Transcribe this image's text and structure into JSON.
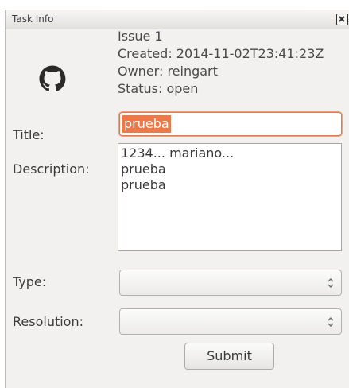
{
  "window": {
    "title": "Task Info"
  },
  "issue": {
    "number": "Issue 1",
    "created": "Created: 2014-11-02T23:41:23Z",
    "owner": "Owner: reingart",
    "status": "Status: open"
  },
  "form": {
    "title_label": "Title:",
    "title_value": "prueba",
    "description_label": "Description:",
    "description_lines": [
      "1234... mariano...",
      "prueba",
      "prueba"
    ],
    "type_label": "Type:",
    "type_value": "",
    "resolution_label": "Resolution:",
    "resolution_value": "",
    "submit_label": "Submit"
  },
  "icons": {
    "logo": "github-icon",
    "close": "close-icon"
  },
  "colors": {
    "selection": "#f07746",
    "focus_border": "#e07b50"
  }
}
